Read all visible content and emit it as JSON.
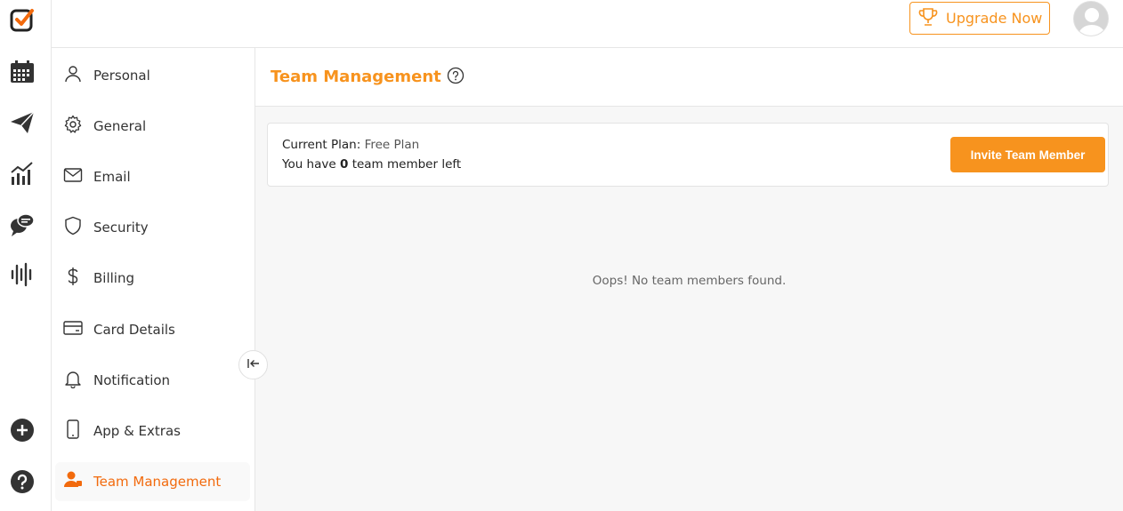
{
  "header": {
    "upgrade_label": "Upgrade Now"
  },
  "rail": {
    "icons": [
      "logo-check-icon",
      "calendar-icon",
      "send-icon",
      "analytics-icon",
      "chat-icon",
      "audio-wave-icon",
      "add-icon",
      "help-icon"
    ]
  },
  "settings_nav": {
    "items": [
      {
        "label": "Personal",
        "icon": "user-icon"
      },
      {
        "label": "General",
        "icon": "gear-icon"
      },
      {
        "label": "Email",
        "icon": "mail-icon"
      },
      {
        "label": "Security",
        "icon": "shield-icon"
      },
      {
        "label": "Billing",
        "icon": "dollar-icon"
      },
      {
        "label": "Card Details",
        "icon": "credit-card-icon"
      },
      {
        "label": "Notification",
        "icon": "bell-icon"
      },
      {
        "label": "App & Extras",
        "icon": "mobile-icon"
      },
      {
        "label": "Team Management",
        "icon": "team-user-icon",
        "active": true
      }
    ]
  },
  "main": {
    "title": "Team Management",
    "plan": {
      "label": "Current Plan:",
      "value": "Free Plan",
      "remaining_prefix": "You have",
      "remaining_count": "0",
      "remaining_suffix": "team member left"
    },
    "invite_label": "Invite Team Member",
    "empty_message": "Oops! No team members found."
  },
  "colors": {
    "accent": "#f7931e",
    "active_text": "#f26a0d"
  }
}
